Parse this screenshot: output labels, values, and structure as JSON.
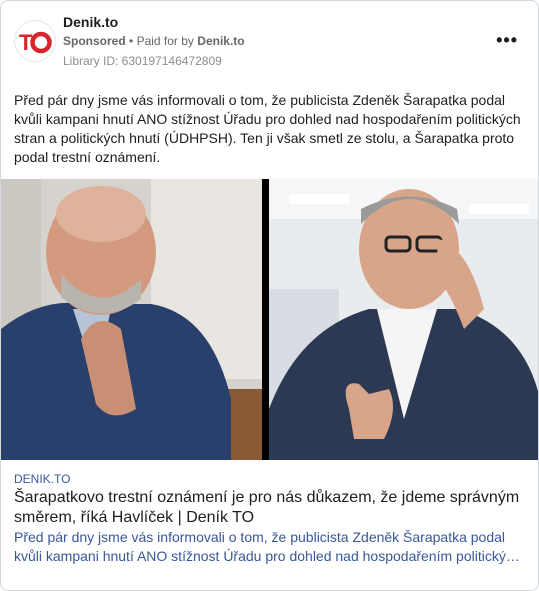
{
  "header": {
    "page_name": "Denik.to",
    "sponsored": "Sponsored",
    "separator": "•",
    "paid_for_prefix": "Paid for by",
    "paid_for_name": "Denik.to",
    "library_id": "Library ID: 630197146472809",
    "more_icon": "•••"
  },
  "post": {
    "text": "Před pár dny jsme vás informovali o tom, že publicista Zdeněk Šarapatka podal kvůli kampani hnutí ANO stížnost Úřadu pro dohled nad hospodařením politických stran a politických hnutí (ÚDHPSH). Ten ji však smetl ze stolu, a Šarapatka proto podal trestní oznámení."
  },
  "link": {
    "domain": "DENIK.TO",
    "headline": "Šarapatkovo trestní oznámení je pro nás důkazem, že jdeme správným směrem, říká Havlíček | Deník TO",
    "description": "Před pár dny jsme vás informovali o tom, že publicista Zdeněk Šarapatka podal kvůli kampani hnutí ANO stížnost Úřadu pro dohled nad hospodařením politických stran a politických hnutí (ÚDHPSH)."
  },
  "colors": {
    "brand_red": "#d9232d",
    "link_blue": "#385898",
    "muted": "#65676b"
  }
}
